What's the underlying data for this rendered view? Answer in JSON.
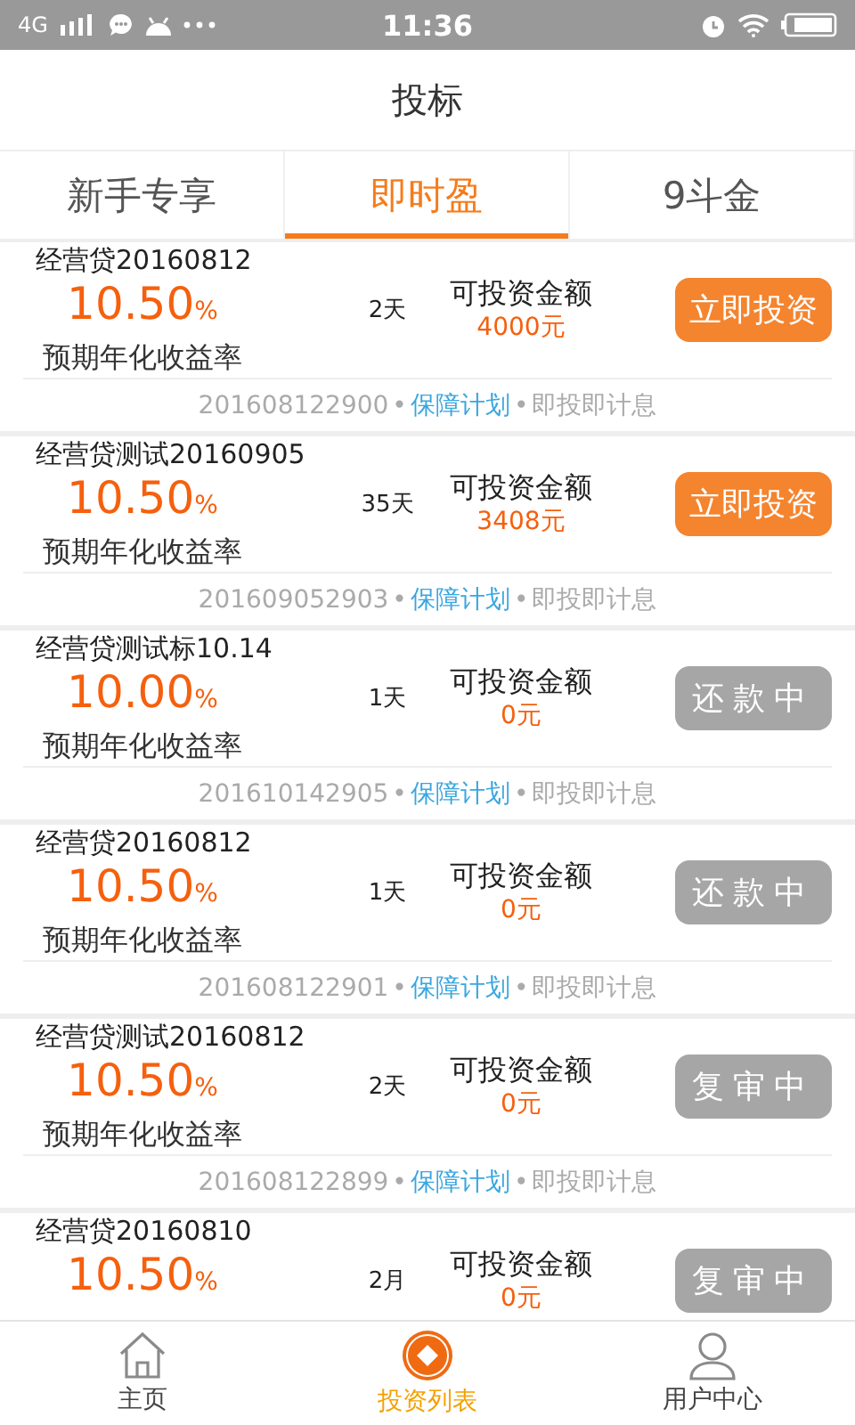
{
  "status_bar": {
    "network": "4G",
    "time": "11:36"
  },
  "header": {
    "title": "投标"
  },
  "tabs": [
    {
      "label": "新手专享",
      "selected": false
    },
    {
      "label": "即时盈",
      "selected": true
    },
    {
      "label": "9斗金",
      "selected": false
    }
  ],
  "separator": "•",
  "loans": [
    {
      "title": "经营贷20160812",
      "rate": "10.50",
      "unit": "%",
      "rate_label": "预期年化收益率",
      "term": "2天",
      "amount_label": "可投资金额",
      "amount": "4000元",
      "action": {
        "label": "立即投资",
        "kind": "invest"
      },
      "code": "201608122900",
      "plan": "保障计划",
      "note": "即投即计息"
    },
    {
      "title": "经营贷测试20160905",
      "rate": "10.50",
      "unit": "%",
      "rate_label": "预期年化收益率",
      "term": "35天",
      "amount_label": "可投资金额",
      "amount": "3408元",
      "action": {
        "label": "立即投资",
        "kind": "invest"
      },
      "code": "201609052903",
      "plan": "保障计划",
      "note": "即投即计息"
    },
    {
      "title": "经营贷测试标10.14",
      "rate": "10.00",
      "unit": "%",
      "rate_label": "预期年化收益率",
      "term": "1天",
      "amount_label": "可投资金额",
      "amount": "0元",
      "action": {
        "label": "还款中",
        "kind": "inactive"
      },
      "code": "201610142905",
      "plan": "保障计划",
      "note": "即投即计息"
    },
    {
      "title": "经营贷20160812",
      "rate": "10.50",
      "unit": "%",
      "rate_label": "预期年化收益率",
      "term": "1天",
      "amount_label": "可投资金额",
      "amount": "0元",
      "action": {
        "label": "还款中",
        "kind": "inactive"
      },
      "code": "201608122901",
      "plan": "保障计划",
      "note": "即投即计息"
    },
    {
      "title": "经营贷测试20160812",
      "rate": "10.50",
      "unit": "%",
      "rate_label": "预期年化收益率",
      "term": "2天",
      "amount_label": "可投资金额",
      "amount": "0元",
      "action": {
        "label": "复审中",
        "kind": "inactive"
      },
      "code": "201608122899",
      "plan": "保障计划",
      "note": "即投即计息"
    },
    {
      "title": "经营贷20160810",
      "rate": "10.50",
      "unit": "%",
      "term": "2月",
      "amount_label": "可投资金额",
      "amount": "0元",
      "action": {
        "label": "复审中",
        "kind": "inactive"
      }
    }
  ],
  "nav": [
    {
      "label": "主页",
      "selected": false
    },
    {
      "label": "投资列表",
      "selected": true
    },
    {
      "label": "用户中心",
      "selected": false
    }
  ]
}
